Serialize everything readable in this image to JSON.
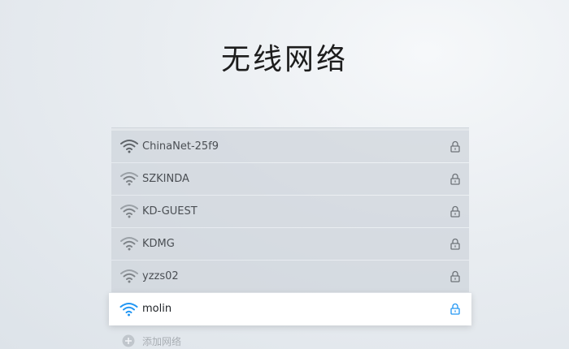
{
  "page": {
    "title": "无线网络"
  },
  "networks": [
    {
      "name": "ChinaNet-25f9",
      "signal": "strong",
      "secured": true,
      "selected": false
    },
    {
      "name": "SZKINDA",
      "signal": "medium",
      "secured": true,
      "selected": false
    },
    {
      "name": "KD-GUEST",
      "signal": "medium",
      "secured": true,
      "selected": false
    },
    {
      "name": "KDMG",
      "signal": "medium",
      "secured": true,
      "selected": false
    },
    {
      "name": "yzzs02",
      "signal": "medium",
      "secured": true,
      "selected": false
    },
    {
      "name": "molin",
      "signal": "strong",
      "secured": true,
      "selected": true
    }
  ],
  "add_network": {
    "label": "添加网络",
    "icon": "plus-circle-icon"
  },
  "icons": {
    "wifi": "wifi-icon",
    "lock": "lock-icon"
  },
  "colors": {
    "accent": "#2196f3",
    "icon_gray": "#6e7378",
    "icon_light_gray": "#8a8f94",
    "row_bg": "#cfd5db",
    "selected_bg": "#ffffff"
  }
}
